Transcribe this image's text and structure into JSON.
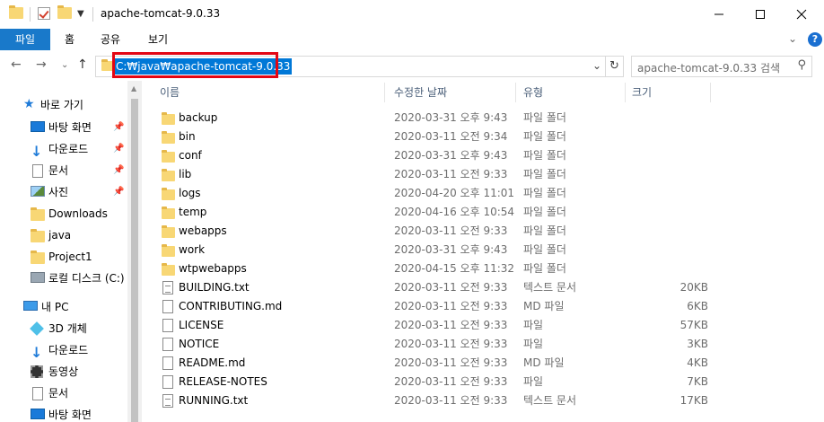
{
  "window": {
    "title": "apache-tomcat-9.0.33",
    "controls": [
      "minimize",
      "maximize",
      "close"
    ]
  },
  "ribbon": {
    "tabs": [
      "파일",
      "홈",
      "공유",
      "보기"
    ]
  },
  "navigation": {
    "address": "C:₩java₩apache-tomcat-9.0.33",
    "search_placeholder": "apache-tomcat-9.0.33 검색"
  },
  "sidebar": {
    "quick_access_label": "바로 가기",
    "quick_access": [
      {
        "label": "바탕 화면",
        "icon": "desktop-icon",
        "pinned": true
      },
      {
        "label": "다운로드",
        "icon": "download-icon",
        "pinned": true
      },
      {
        "label": "문서",
        "icon": "document-icon",
        "pinned": true
      },
      {
        "label": "사진",
        "icon": "pictures-icon",
        "pinned": true
      },
      {
        "label": "Downloads",
        "icon": "folder-icon",
        "pinned": false
      },
      {
        "label": "java",
        "icon": "folder-icon",
        "pinned": false
      },
      {
        "label": "Project1",
        "icon": "folder-icon",
        "pinned": false
      },
      {
        "label": "로컬 디스크 (C:)",
        "icon": "drive-icon",
        "pinned": false
      }
    ],
    "this_pc_label": "내 PC",
    "this_pc": [
      {
        "label": "3D 개체",
        "icon": "3d-objects-icon"
      },
      {
        "label": "다운로드",
        "icon": "download-icon"
      },
      {
        "label": "동영상",
        "icon": "video-icon"
      },
      {
        "label": "문서",
        "icon": "document-icon"
      },
      {
        "label": "바탕 화면",
        "icon": "desktop-icon"
      }
    ]
  },
  "columns": {
    "name": "이름",
    "date": "수정한 날짜",
    "type": "유형",
    "size": "크기"
  },
  "files": [
    {
      "name": "backup",
      "date": "2020-03-31 오후 9:43",
      "type": "파일 폴더",
      "size": "",
      "kind": "folder"
    },
    {
      "name": "bin",
      "date": "2020-03-11 오전 9:34",
      "type": "파일 폴더",
      "size": "",
      "kind": "folder"
    },
    {
      "name": "conf",
      "date": "2020-03-31 오후 9:43",
      "type": "파일 폴더",
      "size": "",
      "kind": "folder"
    },
    {
      "name": "lib",
      "date": "2020-03-11 오전 9:33",
      "type": "파일 폴더",
      "size": "",
      "kind": "folder"
    },
    {
      "name": "logs",
      "date": "2020-04-20 오후 11:01",
      "type": "파일 폴더",
      "size": "",
      "kind": "folder"
    },
    {
      "name": "temp",
      "date": "2020-04-16 오후 10:54",
      "type": "파일 폴더",
      "size": "",
      "kind": "folder"
    },
    {
      "name": "webapps",
      "date": "2020-03-11 오전 9:33",
      "type": "파일 폴더",
      "size": "",
      "kind": "folder"
    },
    {
      "name": "work",
      "date": "2020-03-31 오후 9:43",
      "type": "파일 폴더",
      "size": "",
      "kind": "folder"
    },
    {
      "name": "wtpwebapps",
      "date": "2020-04-15 오후 11:32",
      "type": "파일 폴더",
      "size": "",
      "kind": "folder"
    },
    {
      "name": "BUILDING.txt",
      "date": "2020-03-11 오전 9:33",
      "type": "텍스트 문서",
      "size": "20KB",
      "kind": "text"
    },
    {
      "name": "CONTRIBUTING.md",
      "date": "2020-03-11 오전 9:33",
      "type": "MD 파일",
      "size": "6KB",
      "kind": "blank"
    },
    {
      "name": "LICENSE",
      "date": "2020-03-11 오전 9:33",
      "type": "파일",
      "size": "57KB",
      "kind": "blank"
    },
    {
      "name": "NOTICE",
      "date": "2020-03-11 오전 9:33",
      "type": "파일",
      "size": "3KB",
      "kind": "blank"
    },
    {
      "name": "README.md",
      "date": "2020-03-11 오전 9:33",
      "type": "MD 파일",
      "size": "4KB",
      "kind": "blank"
    },
    {
      "name": "RELEASE-NOTES",
      "date": "2020-03-11 오전 9:33",
      "type": "파일",
      "size": "7KB",
      "kind": "blank"
    },
    {
      "name": "RUNNING.txt",
      "date": "2020-03-11 오전 9:33",
      "type": "텍스트 문서",
      "size": "17KB",
      "kind": "text"
    }
  ]
}
